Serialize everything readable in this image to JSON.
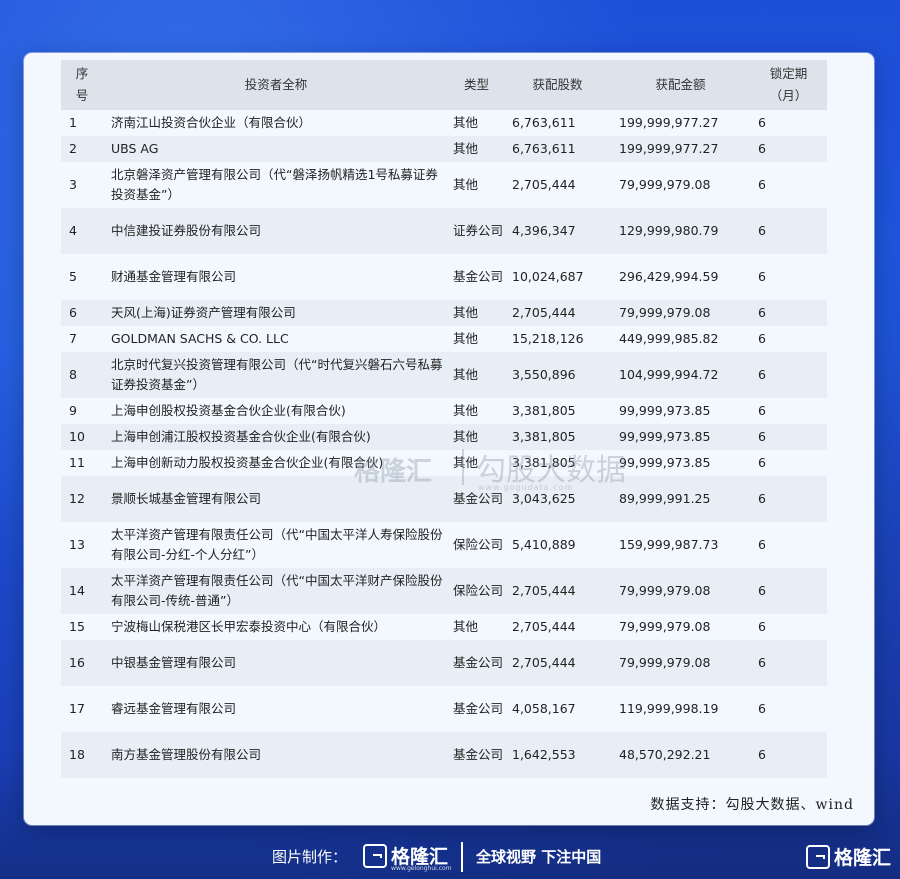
{
  "table": {
    "headers": {
      "seq": "序\n号",
      "name": "投资者全称",
      "type": "类型",
      "shares": "获配股数",
      "amount": "获配金额",
      "lock": "锁定期\n（月）"
    },
    "rows": [
      {
        "seq": "1",
        "name": "济南江山投资合伙企业（有限合伙）",
        "type": "其他",
        "shares": "6,763,611",
        "amount": "199,999,977.27",
        "lock": "6"
      },
      {
        "seq": "2",
        "name": "UBS AG",
        "type": "其他",
        "shares": "6,763,611",
        "amount": "199,999,977.27",
        "lock": "6"
      },
      {
        "seq": "3",
        "name": "北京磐泽资产管理有限公司（代“磐泽扬帆精选1号私募证券投资基金”）",
        "type": "其他",
        "shares": "2,705,444",
        "amount": "79,999,979.08",
        "lock": "6"
      },
      {
        "seq": "4",
        "name": "中信建投证券股份有限公司",
        "type": "证券公司",
        "shares": "4,396,347",
        "amount": "129,999,980.79",
        "lock": "6"
      },
      {
        "seq": "5",
        "name": "财通基金管理有限公司",
        "type": "基金公司",
        "shares": "10,024,687",
        "amount": "296,429,994.59",
        "lock": "6"
      },
      {
        "seq": "6",
        "name": "天风(上海)证券资产管理有限公司",
        "type": "其他",
        "shares": "2,705,444",
        "amount": "79,999,979.08",
        "lock": "6"
      },
      {
        "seq": "7",
        "name": "GOLDMAN SACHS & CO. LLC",
        "type": "其他",
        "shares": "15,218,126",
        "amount": "449,999,985.82",
        "lock": "6"
      },
      {
        "seq": "8",
        "name": "北京时代复兴投资管理有限公司（代“时代复兴磐石六号私募证券投资基金”）",
        "type": "其他",
        "shares": "3,550,896",
        "amount": "104,999,994.72",
        "lock": "6"
      },
      {
        "seq": "9",
        "name": "上海申创股权投资基金合伙企业(有限合伙)",
        "type": "其他",
        "shares": "3,381,805",
        "amount": "99,999,973.85",
        "lock": "6"
      },
      {
        "seq": "10",
        "name": "上海申创浦江股权投资基金合伙企业(有限合伙)",
        "type": "其他",
        "shares": "3,381,805",
        "amount": "99,999,973.85",
        "lock": "6"
      },
      {
        "seq": "11",
        "name": "上海申创新动力股权投资基金合伙企业(有限合伙)",
        "type": "其他",
        "shares": "3,381,805",
        "amount": "99,999,973.85",
        "lock": "6"
      },
      {
        "seq": "12",
        "name": "景顺长城基金管理有限公司",
        "type": "基金公司",
        "shares": "3,043,625",
        "amount": "89,999,991.25",
        "lock": "6"
      },
      {
        "seq": "13",
        "name": "太平洋资产管理有限责任公司（代“中国太平洋人寿保险股份有限公司-分红-个人分红”）",
        "type": "保险公司",
        "shares": "5,410,889",
        "amount": "159,999,987.73",
        "lock": "6"
      },
      {
        "seq": "14",
        "name": "太平洋资产管理有限责任公司（代“中国太平洋财产保险股份有限公司-传统-普通”）",
        "type": "保险公司",
        "shares": "2,705,444",
        "amount": "79,999,979.08",
        "lock": "6"
      },
      {
        "seq": "15",
        "name": "宁波梅山保税港区长甲宏泰投资中心（有限合伙）",
        "type": "其他",
        "shares": "2,705,444",
        "amount": "79,999,979.08",
        "lock": "6"
      },
      {
        "seq": "16",
        "name": "中银基金管理有限公司",
        "type": "基金公司",
        "shares": "2,705,444",
        "amount": "79,999,979.08",
        "lock": "6"
      },
      {
        "seq": "17",
        "name": "睿远基金管理有限公司",
        "type": "基金公司",
        "shares": "4,058,167",
        "amount": "119,999,998.19",
        "lock": "6"
      },
      {
        "seq": "18",
        "name": "南方基金管理股份有限公司",
        "type": "基金公司",
        "shares": "1,642,553",
        "amount": "48,570,292.21",
        "lock": "6"
      }
    ]
  },
  "source": "数据支持：勾股大数据、wind",
  "watermark": {
    "logo": "格隆汇",
    "text": "勾股大数据",
    "url": "www.gogudata.com"
  },
  "footer": {
    "made_by": "图片制作：",
    "brand": "格隆汇",
    "brand_url": "www.gelonghui.com",
    "slogan": "全球视野 下注中国",
    "brand_right": "格隆汇"
  }
}
